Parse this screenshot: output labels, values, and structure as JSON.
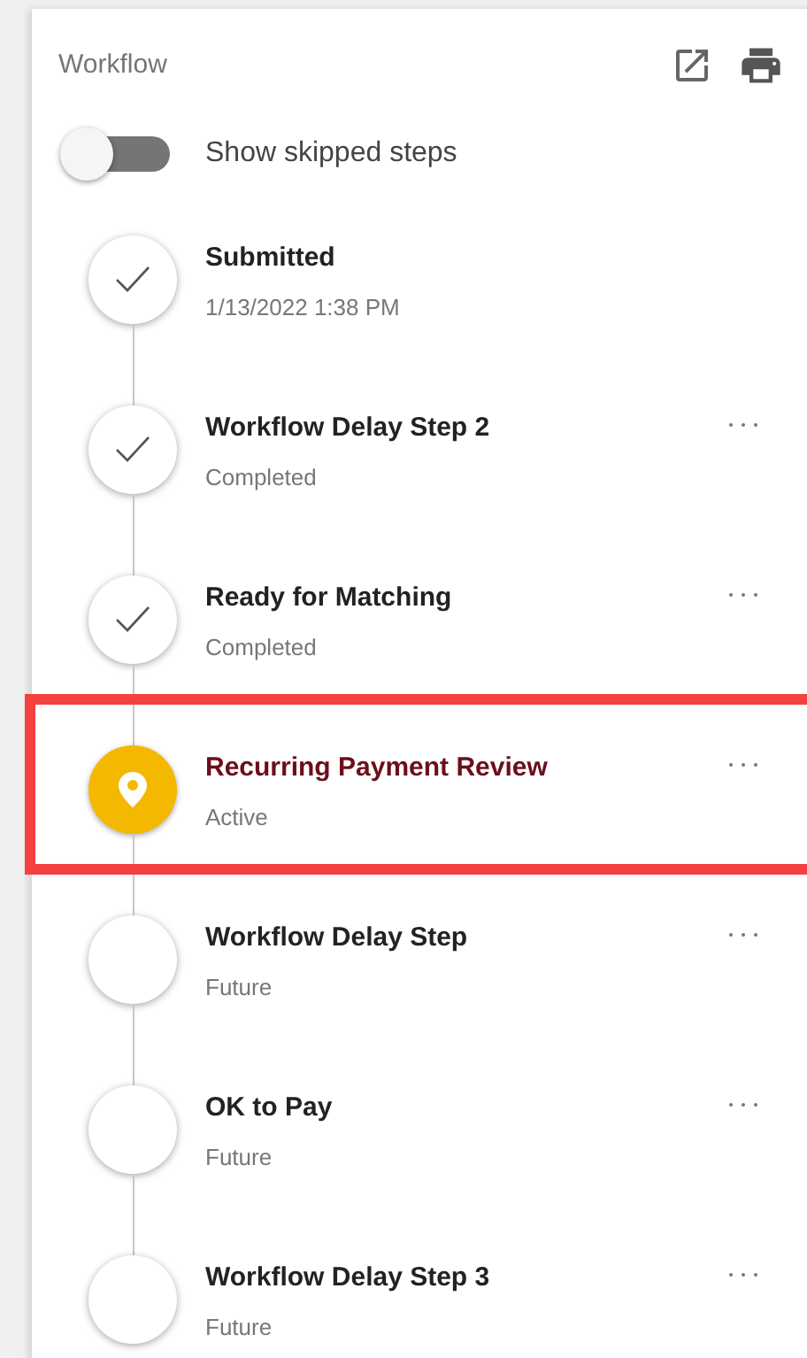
{
  "panel": {
    "title": "Workflow"
  },
  "toggle": {
    "label": "Show skipped steps",
    "on": false
  },
  "steps": [
    {
      "kind": "completed",
      "title": "Submitted",
      "subtitle": "1/13/2022 1:38 PM",
      "has_menu": false,
      "highlighted": false
    },
    {
      "kind": "completed",
      "title": "Workflow Delay Step 2",
      "subtitle": "Completed",
      "has_menu": true,
      "highlighted": false
    },
    {
      "kind": "completed",
      "title": "Ready for Matching",
      "subtitle": "Completed",
      "has_menu": true,
      "highlighted": false
    },
    {
      "kind": "active",
      "title": "Recurring Payment Review",
      "subtitle": "Active",
      "has_menu": true,
      "highlighted": true
    },
    {
      "kind": "future",
      "title": "Workflow Delay Step",
      "subtitle": "Future",
      "has_menu": true,
      "highlighted": false
    },
    {
      "kind": "future",
      "title": "OK to Pay",
      "subtitle": "Future",
      "has_menu": true,
      "highlighted": false
    },
    {
      "kind": "future",
      "title": "Workflow Delay Step 3",
      "subtitle": "Future",
      "has_menu": true,
      "highlighted": false
    }
  ]
}
